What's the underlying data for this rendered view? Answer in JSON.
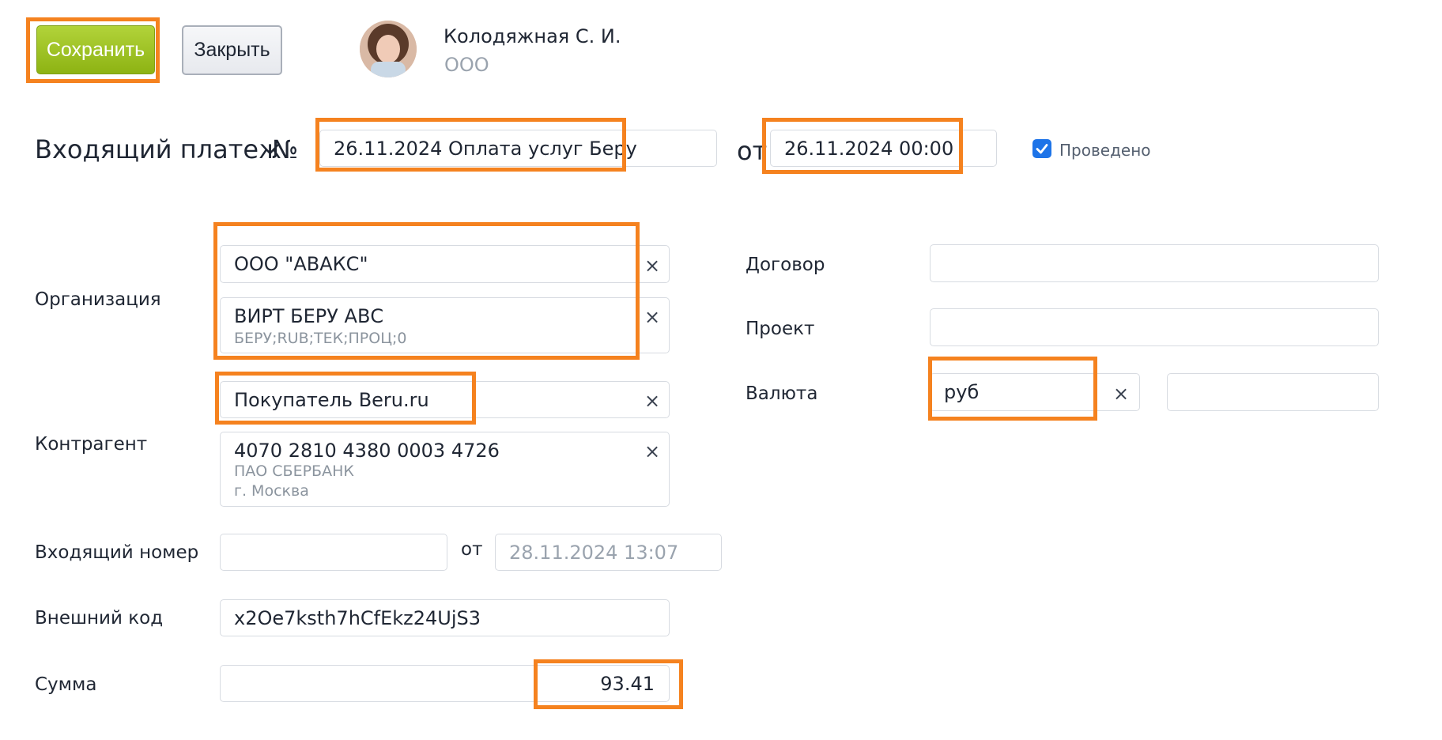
{
  "toolbar": {
    "save_label": "Сохранить",
    "close_label": "Закрыть"
  },
  "user": {
    "name": "Колодяжная С. И.",
    "org": "ООО"
  },
  "doc": {
    "title": "Входящий платеж",
    "number_sign": "№",
    "number_value": "26.11.2024 Оплата услуг Беру",
    "date_label": "от",
    "date_value": "26.11.2024 00:00",
    "posted_label": "Проведено",
    "posted": true
  },
  "form": {
    "organization": {
      "label": "Организация",
      "org_value": "ООО \"АВАКС\"",
      "account_value": "ВИРТ БЕРУ АВС",
      "account_sub": "БЕРУ;RUB;ТЕК;ПРОЦ;0"
    },
    "counterparty": {
      "label": "Контрагент",
      "name_value": "Покупатель Beru.ru",
      "account_value": "4070 2810 4380 0003 4726",
      "bank_name": "ПАО СБЕРБАНК",
      "bank_city": "г. Москва"
    },
    "incoming_number": {
      "label": "Входящий номер",
      "value": "",
      "date_label": "от",
      "date_placeholder": "28.11.2024 13:07"
    },
    "external_code": {
      "label": "Внешний код",
      "value": "x2Oe7ksth7hCfEkz24UjS3"
    },
    "amount": {
      "label": "Сумма",
      "value": "93.41"
    },
    "contract": {
      "label": "Договор",
      "value": ""
    },
    "project": {
      "label": "Проект",
      "value": ""
    },
    "currency": {
      "label": "Валюта",
      "value": "руб",
      "rate_value": ""
    },
    "clear_symbol": "×"
  },
  "colors": {
    "highlight": "#f5821f",
    "save_button": "#9cc21f",
    "checkbox": "#1e74e8"
  }
}
